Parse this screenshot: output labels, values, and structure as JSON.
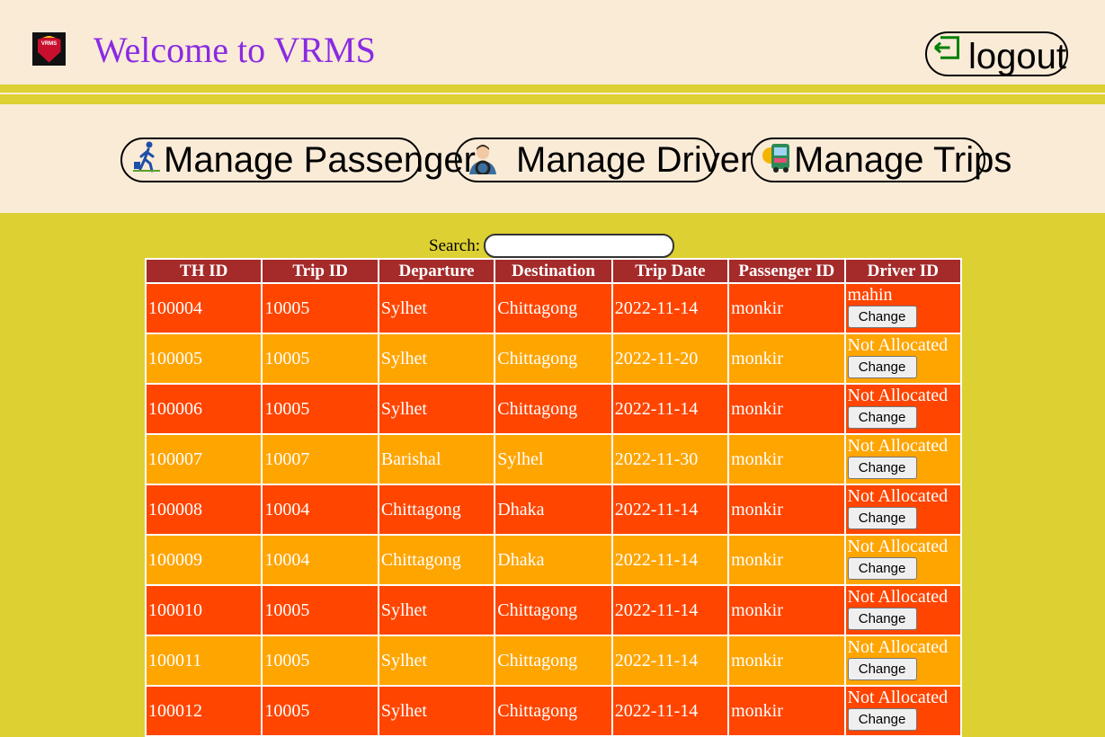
{
  "header": {
    "logo_text": "VRMS",
    "title": "Welcome to VRMS",
    "logout_label": "logout"
  },
  "nav": {
    "passenger_label": "Manage Passenger",
    "driver_label": "Manage Driver",
    "trips_label": "Manage Trips"
  },
  "search": {
    "label": "Search:",
    "value": ""
  },
  "table": {
    "columns": [
      "TH ID",
      "Trip ID",
      "Departure",
      "Destination",
      "Trip Date",
      "Passenger ID",
      "Driver ID"
    ],
    "change_label": "Change",
    "rows": [
      {
        "th_id": "100004",
        "trip_id": "10005",
        "departure": "Sylhet",
        "destination": "Chittagong",
        "date": "2022-11-14",
        "passenger": "monkir",
        "driver": "mahin"
      },
      {
        "th_id": "100005",
        "trip_id": "10005",
        "departure": "Sylhet",
        "destination": "Chittagong",
        "date": "2022-11-20",
        "passenger": "monkir",
        "driver": "Not Allocated"
      },
      {
        "th_id": "100006",
        "trip_id": "10005",
        "departure": "Sylhet",
        "destination": "Chittagong",
        "date": "2022-11-14",
        "passenger": "monkir",
        "driver": "Not Allocated"
      },
      {
        "th_id": "100007",
        "trip_id": "10007",
        "departure": "Barishal",
        "destination": "Sylhel",
        "date": "2022-11-30",
        "passenger": "monkir",
        "driver": "Not Allocated"
      },
      {
        "th_id": "100008",
        "trip_id": "10004",
        "departure": "Chittagong",
        "destination": "Dhaka",
        "date": "2022-11-14",
        "passenger": "monkir",
        "driver": "Not Allocated"
      },
      {
        "th_id": "100009",
        "trip_id": "10004",
        "departure": "Chittagong",
        "destination": "Dhaka",
        "date": "2022-11-14",
        "passenger": "monkir",
        "driver": "Not Allocated"
      },
      {
        "th_id": "100010",
        "trip_id": "10005",
        "departure": "Sylhet",
        "destination": "Chittagong",
        "date": "2022-11-14",
        "passenger": "monkir",
        "driver": "Not Allocated"
      },
      {
        "th_id": "100011",
        "trip_id": "10005",
        "departure": "Sylhet",
        "destination": "Chittagong",
        "date": "2022-11-14",
        "passenger": "monkir",
        "driver": "Not Allocated"
      },
      {
        "th_id": "100012",
        "trip_id": "10005",
        "departure": "Sylhet",
        "destination": "Chittagong",
        "date": "2022-11-14",
        "passenger": "monkir",
        "driver": "Not Allocated"
      }
    ]
  },
  "colors": {
    "background": "#ddd032",
    "header_bg": "#faebd7",
    "title_color": "#8a2be2",
    "table_head": "#a52a2a",
    "row_odd": "#ff4500",
    "row_even": "#ffa500",
    "logout_icon": "#008000"
  },
  "icons": {
    "logo": "vrms-shield-icon",
    "logout": "logout-arrow-icon",
    "passenger": "walking-passenger-icon",
    "driver": "driver-icon",
    "trips": "bus-icon"
  }
}
